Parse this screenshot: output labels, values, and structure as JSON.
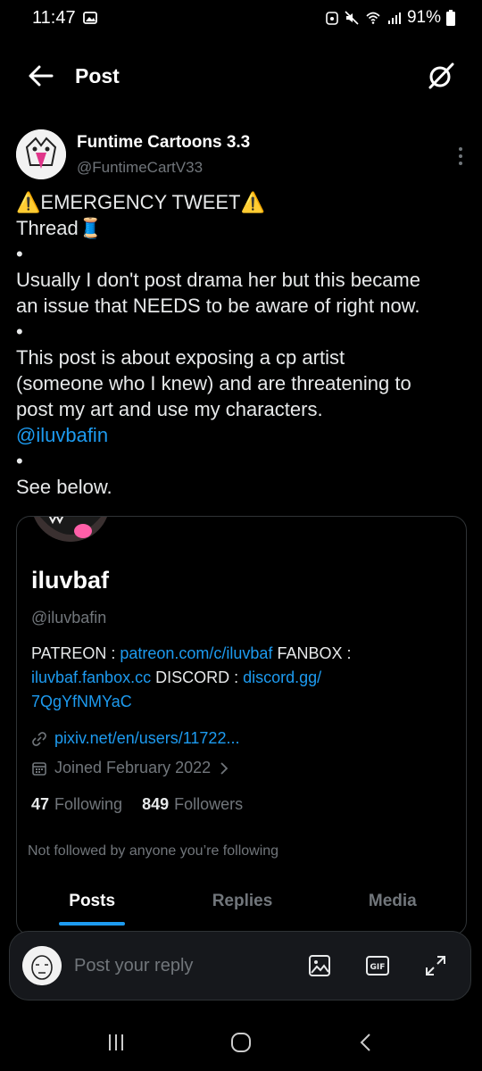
{
  "status_bar": {
    "time": "11:47",
    "battery": "91%"
  },
  "header": {
    "title": "Post"
  },
  "tweet": {
    "author_name": "Funtime Cartoons 3.3",
    "author_handle": "@FuntimeCartV33",
    "lines": {
      "l1": "⚠️EMERGENCY TWEET⚠️",
      "l2": "Thread🧵",
      "bullet1": "•",
      "l3": "Usually I don't post drama her but this became",
      "l4": "an issue that NEEDS to be aware of right now.",
      "bullet2": "•",
      "l5": "This post is about exposing a cp artist",
      "l6": "(someone who I knew) and are threatening to",
      "l7": "post my art and use my characters.",
      "mention": "@iluvbafin",
      "bullet3": "•",
      "l8": "See below."
    }
  },
  "card": {
    "name": "iluvbaf",
    "handle": "@iluvbafin",
    "bio": {
      "patreon_label": "PATREON : ",
      "patreon_link": "patreon.com/c/iluvbaf",
      "fanbox_label": " FANBOX :",
      "fanbox_link": "iluvbaf.fanbox.cc",
      "discord_label": " DISCORD : ",
      "discord_link_a": "discord.gg/",
      "discord_link_b": "7QgYfNMYaC"
    },
    "website": "pixiv.net/en/users/11722...",
    "joined": "Joined February 2022",
    "following_count": "47",
    "following_label": "Following",
    "followers_count": "849",
    "followers_label": "Followers",
    "not_followed": "Not followed by anyone you’re following",
    "tabs": [
      "Posts",
      "Replies",
      "Media"
    ]
  },
  "reply": {
    "placeholder": "Post your reply"
  },
  "colors": {
    "background": "#000000",
    "link": "#1d9bf0",
    "secondary_text": "#71767b"
  }
}
